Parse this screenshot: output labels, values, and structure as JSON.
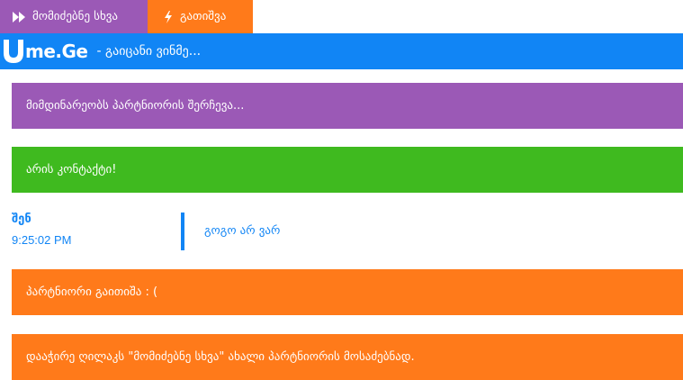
{
  "toolbar": {
    "next_label": "მომიძებნე სხვა",
    "next_icon": "fast-forward-icon",
    "disconnect_label": "გათიშვა",
    "disconnect_icon": "lightning-bolt-icon"
  },
  "brand": {
    "logo_text": "me.Ge",
    "tagline": "- გაიცანი ვინმე..."
  },
  "colors": {
    "purple": "#9b59b6",
    "orange": "#ff7a1a",
    "blue": "#1185f5",
    "green": "#3fba1f"
  },
  "messages": {
    "searching": "მიმდინარეობს პარტნიორის შერჩევა...",
    "connected": "არის კონტაქტი!",
    "chat": {
      "sender": "შენ",
      "time": "9:25:02 PM",
      "text": "გოგო არ ვარ"
    },
    "partner_left": "პარტნიორი გაითიშა : (",
    "hint": "დააჭირე ღილაკს \"მომიძებნე სხვა\" ახალი პარტნიორის მოსაძებნად."
  }
}
